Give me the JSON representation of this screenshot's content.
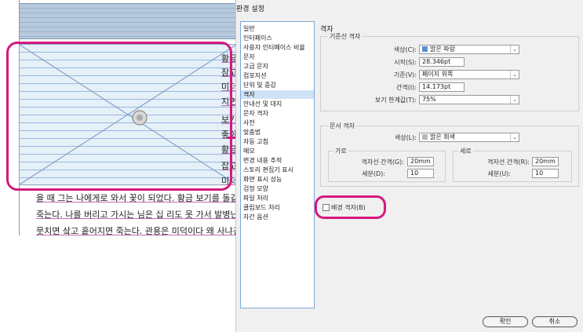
{
  "document": {
    "right_column_chars": [
      "황금",
      "잠고",
      "미더",
      "지면",
      "보기",
      "좋아",
      "황금",
      "잡고",
      "미더"
    ],
    "body_lines": [
      "을 때 그는 나에게로 와서 꽃이 되었다. 황금 보기를 돌같",
      "죽는다. 나를 버리고 가시는 님은 십 리도 못 가서 발병난",
      "뭇치면 샄고 흩어지면 죽는다. 관용은 미덕이다 왜 사냐건"
    ]
  },
  "dialog": {
    "title": "환경 설정",
    "nav_items": [
      "일반",
      "인터페이스",
      "사용자 인터페이스 비율",
      "문자",
      "고급 문자",
      "컴포지션",
      "단위 및 증감",
      "격자",
      "안내선 및 대지",
      "문자 격자",
      "사전",
      "맞춤법",
      "자동 고침",
      "메모",
      "변경 내용 추적",
      "스토리 편집기 표시",
      "화면 표시 성능",
      "검정 모양",
      "파일 처리",
      "클립보드 처리",
      "자간 옵션"
    ],
    "selected_nav": "격자",
    "panel_title": "격자",
    "baseline": {
      "group_label": "기준선 격자",
      "color_label": "색상(C):",
      "color_value": "밝은 파랑",
      "color_swatch": "#5b8fd6",
      "start_label": "시작(S):",
      "start_value": "28.346pt",
      "relative_label": "기준(V):",
      "relative_value": "페이지 위쪽",
      "increment_label": "간격(I):",
      "increment_value": "14.173pt",
      "threshold_label": "보기 한계값(T):",
      "threshold_value": "75%"
    },
    "document_grid": {
      "group_label": "문서 격자",
      "color_label": "색상(L):",
      "color_value": "밝은 회색",
      "color_swatch": "#b8b8b8",
      "horizontal_label": "가로",
      "h_gridline_label": "격자선 간격(G):",
      "h_gridline_value": "20mm",
      "h_subdiv_label": "세분(D):",
      "h_subdiv_value": "10",
      "vertical_label": "세로",
      "v_gridline_label": "격자선 간격(R):",
      "v_gridline_value": "20mm",
      "v_subdiv_label": "세분(U):",
      "v_subdiv_value": "10"
    },
    "background_grid_label": "배경 격자(B)",
    "ok_label": "확인",
    "cancel_label": "취소"
  },
  "colors": {
    "highlight": "#d4197e",
    "nav_selected": "#cfe3f7"
  }
}
